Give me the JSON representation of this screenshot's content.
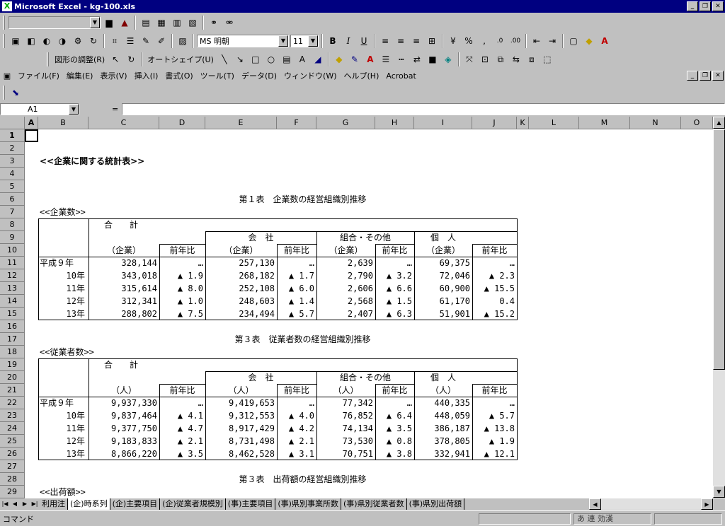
{
  "window": {
    "title": "Microsoft Excel - kg-100.xls",
    "app_icon": "excel-icon"
  },
  "font": {
    "name": "MS 明朝",
    "size": "11"
  },
  "drawing_toolbar": {
    "adjust": "図形の調整(R)",
    "autoshape": "オートシェイプ(U)"
  },
  "menu": [
    "ファイル(F)",
    "編集(E)",
    "表示(V)",
    "挿入(I)",
    "書式(O)",
    "ツール(T)",
    "データ(D)",
    "ウィンドウ(W)",
    "ヘルプ(H)",
    "Acrobat"
  ],
  "formula": {
    "cell_ref": "A1",
    "eq": "=",
    "value": ""
  },
  "columns": [
    "A",
    "B",
    "C",
    "D",
    "E",
    "F",
    "G",
    "H",
    "I",
    "J",
    "K",
    "L",
    "M",
    "N",
    "O"
  ],
  "rows": [
    "1",
    "2",
    "3",
    "4",
    "5",
    "6",
    "7",
    "8",
    "9",
    "10",
    "11",
    "12",
    "13",
    "14",
    "15",
    "16",
    "17",
    "18",
    "19",
    "20",
    "21",
    "22",
    "23",
    "24",
    "25",
    "26",
    "27",
    "28",
    "29"
  ],
  "sheet": {
    "heading": "<<企業に関する統計表>>",
    "t1": {
      "title": "第１表　企業数の経営組織別推移",
      "sub": "<<企業数>>",
      "total": "合　　計",
      "company": "会　社",
      "union": "組合・その他",
      "individual": "個　人",
      "unit": "（企業）",
      "yoy": "前年比",
      "rows": [
        {
          "year": "平成９年",
          "c": "328,144",
          "d": "…",
          "e": "257,130",
          "f": "…",
          "g": "2,639",
          "h": "…",
          "i": "69,375",
          "j": "…"
        },
        {
          "year": "10年",
          "c": "343,018",
          "d": "▲ 1.9",
          "e": "268,182",
          "f": "▲ 1.7",
          "g": "2,790",
          "h": "▲ 3.2",
          "i": "72,046",
          "j": "▲ 2.3"
        },
        {
          "year": "11年",
          "c": "315,614",
          "d": "▲ 8.0",
          "e": "252,108",
          "f": "▲ 6.0",
          "g": "2,606",
          "h": "▲ 6.6",
          "i": "60,900",
          "j": "▲ 15.5"
        },
        {
          "year": "12年",
          "c": "312,341",
          "d": "▲ 1.0",
          "e": "248,603",
          "f": "▲ 1.4",
          "g": "2,568",
          "h": "▲ 1.5",
          "i": "61,170",
          "j": "0.4"
        },
        {
          "year": "13年",
          "c": "288,802",
          "d": "▲ 7.5",
          "e": "234,494",
          "f": "▲ 5.7",
          "g": "2,407",
          "h": "▲ 6.3",
          "i": "51,901",
          "j": "▲ 15.2"
        }
      ]
    },
    "t2": {
      "title": "第３表　従業者数の経営組織別推移",
      "sub": "<<従業者数>>",
      "total": "合　　計",
      "company": "会　社",
      "union": "組合・その他",
      "individual": "個　人",
      "unit": "（人）",
      "yoy": "前年比",
      "rows": [
        {
          "year": "平成９年",
          "c": "9,937,330",
          "d": "…",
          "e": "9,419,653",
          "f": "…",
          "g": "77,342",
          "h": "…",
          "i": "440,335",
          "j": "…"
        },
        {
          "year": "10年",
          "c": "9,837,464",
          "d": "▲ 4.1",
          "e": "9,312,553",
          "f": "▲ 4.0",
          "g": "76,852",
          "h": "▲ 6.4",
          "i": "448,059",
          "j": "▲ 5.7"
        },
        {
          "year": "11年",
          "c": "9,377,750",
          "d": "▲ 4.7",
          "e": "8,917,429",
          "f": "▲ 4.2",
          "g": "74,134",
          "h": "▲ 3.5",
          "i": "386,187",
          "j": "▲ 13.8"
        },
        {
          "year": "12年",
          "c": "9,183,833",
          "d": "▲ 2.1",
          "e": "8,731,498",
          "f": "▲ 2.1",
          "g": "73,530",
          "h": "▲ 0.8",
          "i": "378,805",
          "j": "▲ 1.9"
        },
        {
          "year": "13年",
          "c": "8,866,220",
          "d": "▲ 3.5",
          "e": "8,462,528",
          "f": "▲ 3.1",
          "g": "70,751",
          "h": "▲ 3.8",
          "i": "332,941",
          "j": "▲ 12.1"
        }
      ]
    },
    "t3": {
      "title": "第３表　出荷額の経営組織別推移",
      "sub": "<<出荷額>>"
    }
  },
  "tabs": [
    "利用注",
    "(企)時系列",
    "(企)主要項目",
    "(企)従業者規模別",
    "(事)主要項目",
    "(事)県別事業所数",
    "(事)県別従業者数",
    "(事)県別出荷額"
  ],
  "status": {
    "mode": "コマンド",
    "ime": "あ 連 効漢"
  }
}
